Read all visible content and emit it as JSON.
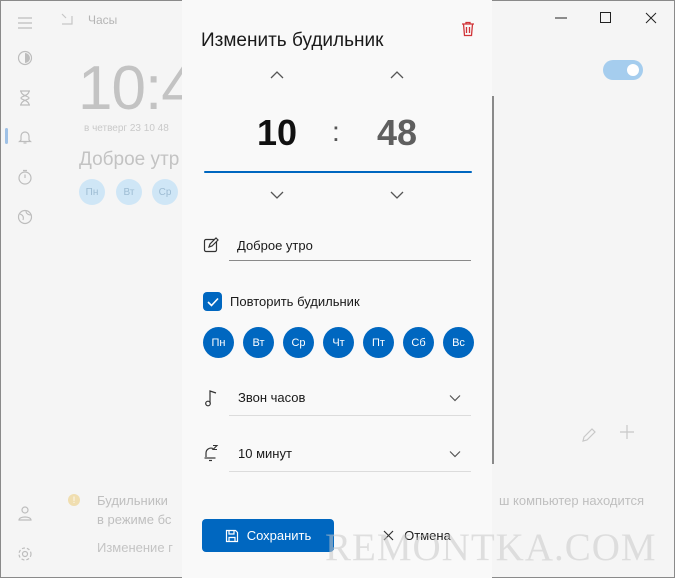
{
  "app": {
    "title": "Часы",
    "bg_clock": "10:4",
    "bg_clock_sub": "в четверг 23 10 48",
    "bg_alarm_name": "Доброе утр",
    "bg_days": [
      "Пн",
      "Вт",
      "Ср"
    ],
    "notice_line1": "Будильники",
    "notice_line2": "в режиме бс",
    "notice_line3": "Изменение г",
    "notice_right": "ш компьютер находится",
    "colors": {
      "accent": "#0067c0",
      "toggle": "#a5cdee"
    }
  },
  "window_controls": {
    "minimize": "—",
    "maximize": "☐",
    "close": "✕"
  },
  "dialog": {
    "title": "Изменить будильник",
    "hours": "10",
    "separator": ":",
    "minutes": "48",
    "alarm_name": "Доброе утро",
    "repeat_label": "Повторить будильник",
    "repeat_checked": true,
    "days": [
      "Пн",
      "Вт",
      "Ср",
      "Чт",
      "Пт",
      "Сб",
      "Вс"
    ],
    "sound": "Звон часов",
    "snooze": "10 минут",
    "save_label": "Сохранить",
    "cancel_label": "Отмена"
  },
  "watermark": "REMONTKA.COM"
}
